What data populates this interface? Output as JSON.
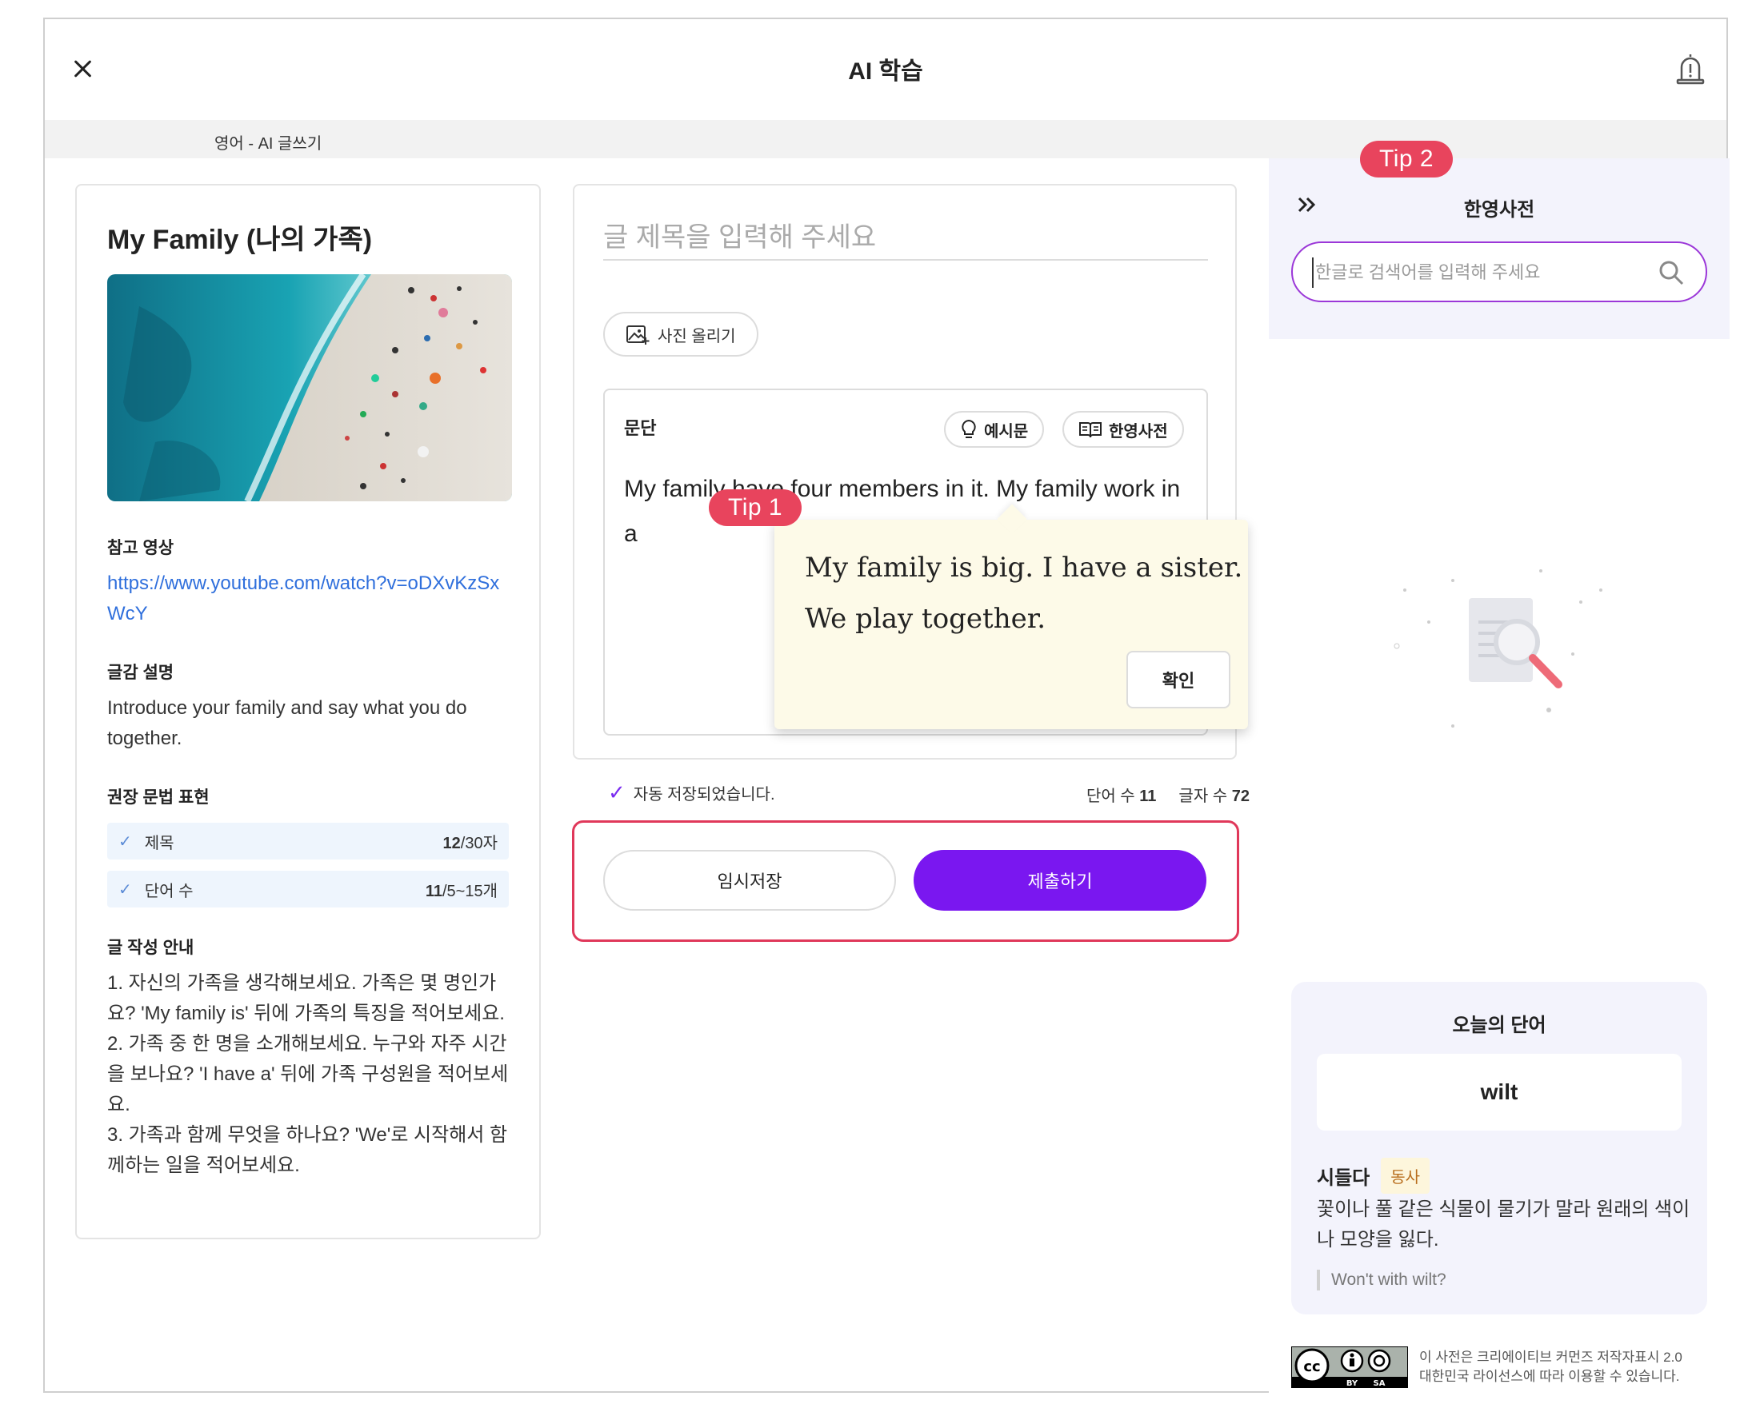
{
  "app": {
    "title": "AI 학습",
    "breadcrumb": "영어 - AI 글쓰기"
  },
  "left": {
    "title": "My Family (나의 가족)",
    "ref_label": "참고 영상",
    "ref_link": "https://www.youtube.com/watch?v=oDXvKzSxWcY",
    "desc_label": "글감 설명",
    "desc_text": "Introduce your family and say what you do together.",
    "grammar_label": "권장 문법 표현",
    "grammar_rows": [
      {
        "label": "제목",
        "count": "12",
        "limit": "/30자"
      },
      {
        "label": "단어 수",
        "count": "11",
        "limit": "/5~15개"
      }
    ],
    "guide_label": "글 작성 안내",
    "guide_items": [
      "1. 자신의 가족을 생각해보세요. 가족은 몇 명인가요? 'My family is' 뒤에 가족의 특징을 적어보세요.",
      "2. 가족 중 한 명을 소개해보세요. 누구와 자주 시간을 보나요? 'I have a' 뒤에 가족 구성원을 적어보세요.",
      "3. 가족과 함께 무엇을 하나요? 'We'로 시작해서 함께하는 일을 적어보세요."
    ]
  },
  "editor": {
    "title_placeholder": "글 제목을 입력해 주세요",
    "photo_button": "사진 올리기",
    "paragraph_label": "문단",
    "example_button": "예시문",
    "dict_button": "한영사전",
    "paragraph_text": "My family have four members in it. My family work in a",
    "autosave": "자동 저장되었습니다.",
    "word_count_label": "단어 수",
    "word_count": "11",
    "char_count_label": "글자 수",
    "char_count": "72",
    "save_button": "임시저장",
    "submit_button": "제출하기"
  },
  "tooltip": {
    "badge": "Tip 1",
    "line1": "My family is big. I have a sister.",
    "line2": "We play together.",
    "ok_button": "확인"
  },
  "dictionary": {
    "badge": "Tip 2",
    "collapse": "»",
    "title": "한영사전",
    "search_placeholder": "한글로 검색어를 입력해 주세요"
  },
  "word_of_day": {
    "title": "오늘의 단어",
    "word": "wilt",
    "meaning": "시들다",
    "pos": "동사",
    "definition": "꽃이나 풀 같은 식물이 물기가 말라 원래의 색이나 모양을 잃다.",
    "example": "Won't with wilt?"
  },
  "license": {
    "line1": "이 사전은 크리에이티브 커먼즈 저작자표시 2.0",
    "line2": "대한민국 라이선스에 따라 이용할 수 있습니다.",
    "logo_text": [
      "cc",
      "BY",
      "SA"
    ]
  },
  "colors": {
    "accent_purple": "#7a17f0",
    "tip_red": "#e8445d",
    "link_blue": "#2f6fdc",
    "panel_bg": "#f3f3fc",
    "tooltip_bg": "#fdfae8"
  },
  "icons": [
    "close-icon",
    "alert-bell-icon",
    "image-upload-icon",
    "lightbulb-icon",
    "dictionary-book-icon",
    "check-icon",
    "search-icon",
    "double-chevron-right-icon",
    "magnifier-document-illustration",
    "creative-commons-logo"
  ]
}
